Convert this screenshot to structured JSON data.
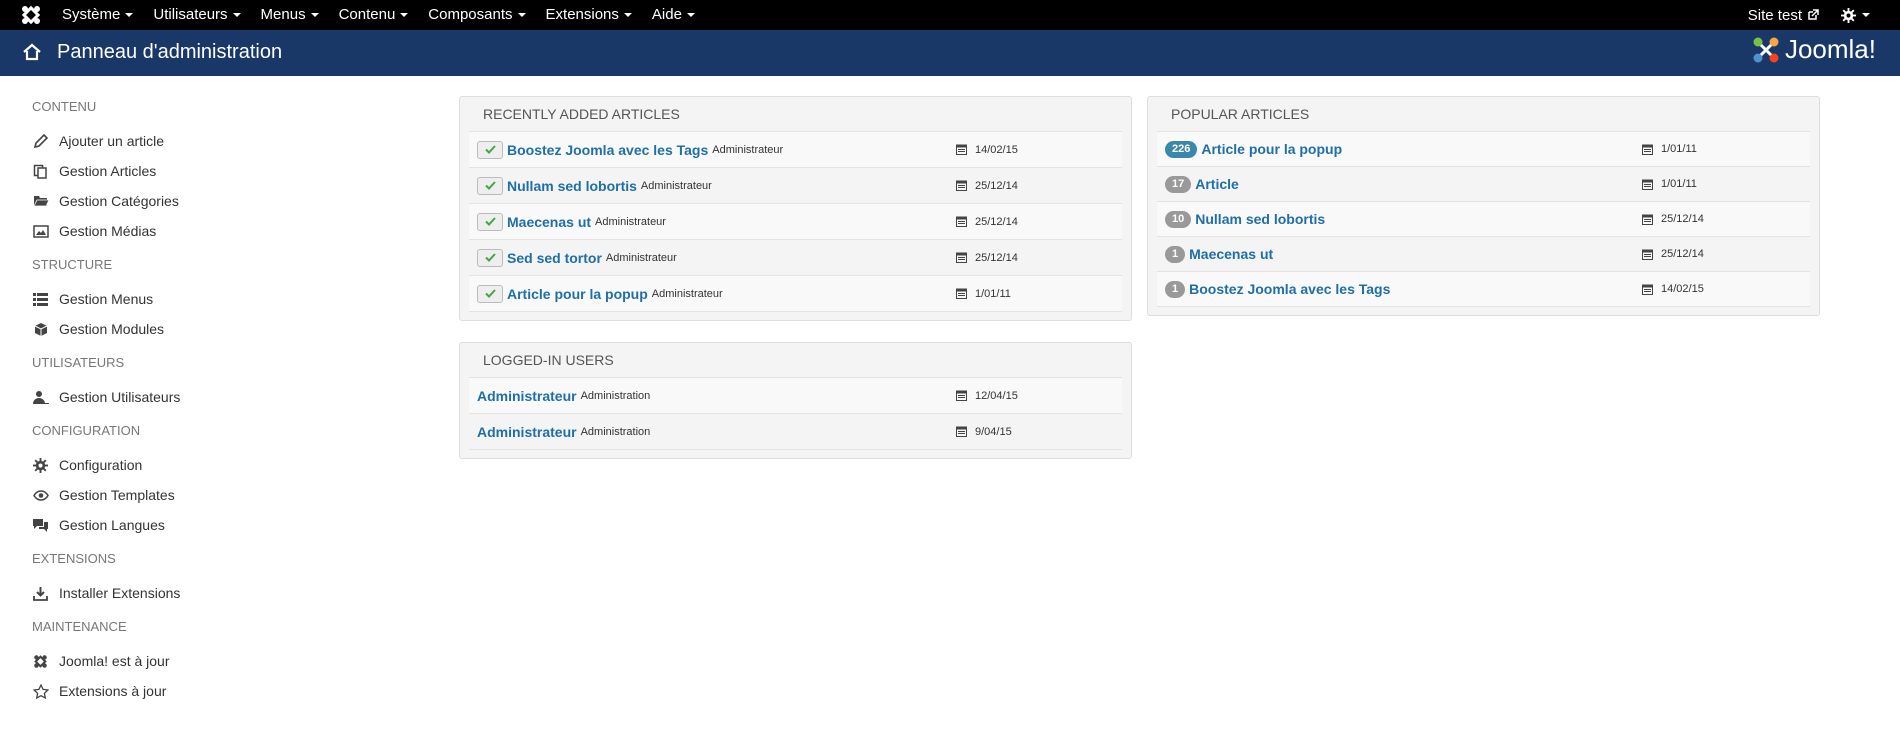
{
  "topnav": {
    "menu": [
      "Système",
      "Utilisateurs",
      "Menus",
      "Contenu",
      "Composants",
      "Extensions",
      "Aide"
    ],
    "site_link": "Site test"
  },
  "header": {
    "title": "Panneau d'administration",
    "logo_text": "Joomla!"
  },
  "sidebar": {
    "sections": [
      {
        "title": "CONTENU",
        "items": [
          "Ajouter un article",
          "Gestion Articles",
          "Gestion Catégories",
          "Gestion Médias"
        ]
      },
      {
        "title": "STRUCTURE",
        "items": [
          "Gestion Menus",
          "Gestion Modules"
        ]
      },
      {
        "title": "UTILISATEURS",
        "items": [
          "Gestion Utilisateurs"
        ]
      },
      {
        "title": "CONFIGURATION",
        "items": [
          "Configuration",
          "Gestion Templates",
          "Gestion Langues"
        ]
      },
      {
        "title": "EXTENSIONS",
        "items": [
          "Installer Extensions"
        ]
      },
      {
        "title": "MAINTENANCE",
        "items": [
          "Joomla! est à jour",
          "Extensions à jour"
        ]
      }
    ]
  },
  "recent": {
    "title": "RECENTLY ADDED ARTICLES",
    "rows": [
      {
        "title": "Boostez Joomla avec les Tags",
        "author": "Administrateur",
        "date": "14/02/15"
      },
      {
        "title": "Nullam sed lobortis",
        "author": "Administrateur",
        "date": "25/12/14"
      },
      {
        "title": "Maecenas ut",
        "author": "Administrateur",
        "date": "25/12/14"
      },
      {
        "title": "Sed sed tortor",
        "author": "Administrateur",
        "date": "25/12/14"
      },
      {
        "title": "Article pour la popup",
        "author": "Administrateur",
        "date": "1/01/11"
      }
    ]
  },
  "logged": {
    "title": "LOGGED-IN USERS",
    "rows": [
      {
        "name": "Administrateur",
        "area": "Administration",
        "date": "12/04/15"
      },
      {
        "name": "Administrateur",
        "area": "Administration",
        "date": "9/04/15"
      }
    ]
  },
  "popular": {
    "title": "POPULAR ARTICLES",
    "rows": [
      {
        "hits": "226",
        "title": "Article pour la popup",
        "date": "1/01/11"
      },
      {
        "hits": "17",
        "title": "Article",
        "date": "1/01/11"
      },
      {
        "hits": "10",
        "title": "Nullam sed lobortis",
        "date": "25/12/14"
      },
      {
        "hits": "1",
        "title": "Maecenas ut",
        "date": "25/12/14"
      },
      {
        "hits": "1",
        "title": "Boostez Joomla avec les Tags",
        "date": "14/02/15"
      }
    ]
  },
  "colors": {
    "navbar": "#000000",
    "header": "#1a3867",
    "link": "#1f6fa7",
    "badge_hot": "#3a87ad",
    "badge": "#999999"
  }
}
